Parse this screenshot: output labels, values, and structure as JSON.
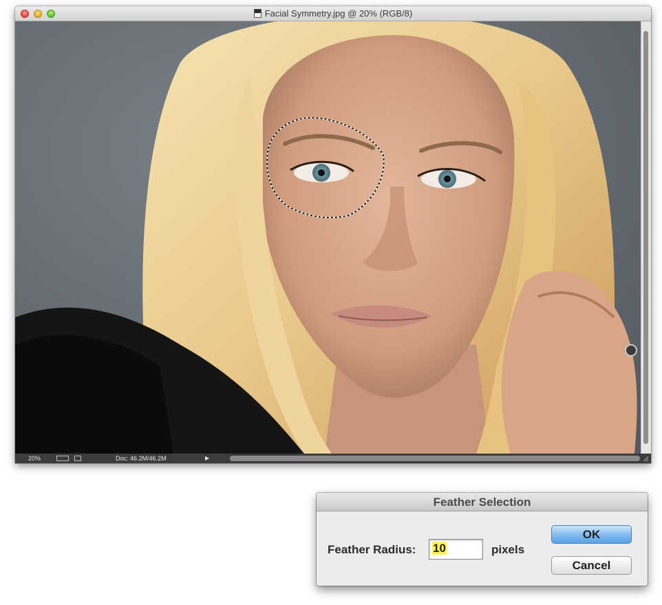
{
  "document": {
    "title": "Facial Symmetry.jpg @ 20% (RGB/8)",
    "zoom": "20%",
    "doc_size": "Doc: 46.2M/46.2M",
    "status_menu_arrow": "▶"
  },
  "dialog": {
    "title": "Feather Selection",
    "field_label": "Feather Radius:",
    "radius_value": "10",
    "unit": "pixels",
    "ok_label": "OK",
    "cancel_label": "Cancel"
  },
  "colors": {
    "backdrop": "#6b7278",
    "ok_button": "#7fb9ee",
    "field_highlight": "#fff45c",
    "status_bar": "#3c3c3c"
  },
  "icons": [
    "close-icon",
    "minimize-icon",
    "zoom-icon",
    "psd-file-icon",
    "timeline-icon",
    "share-icon",
    "resize-grip-icon"
  ]
}
